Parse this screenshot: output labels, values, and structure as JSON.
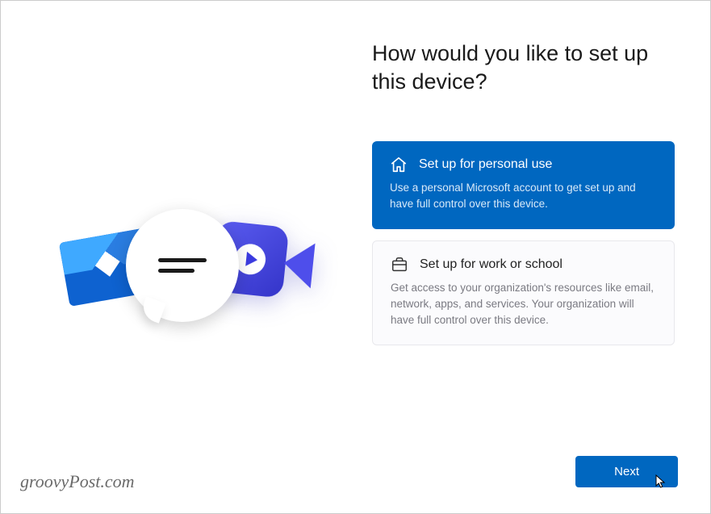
{
  "heading": "How would you like to set up this device?",
  "options": [
    {
      "icon": "home-icon",
      "title": "Set up for personal use",
      "desc": "Use a personal Microsoft account to get set up and have full control over this device.",
      "selected": true
    },
    {
      "icon": "briefcase-icon",
      "title": "Set up for work or school",
      "desc": "Get access to your organization's resources like email, network, apps, and services. Your organization will have full control over this device.",
      "selected": false
    }
  ],
  "next_label": "Next",
  "watermark": "groovyPost.com"
}
